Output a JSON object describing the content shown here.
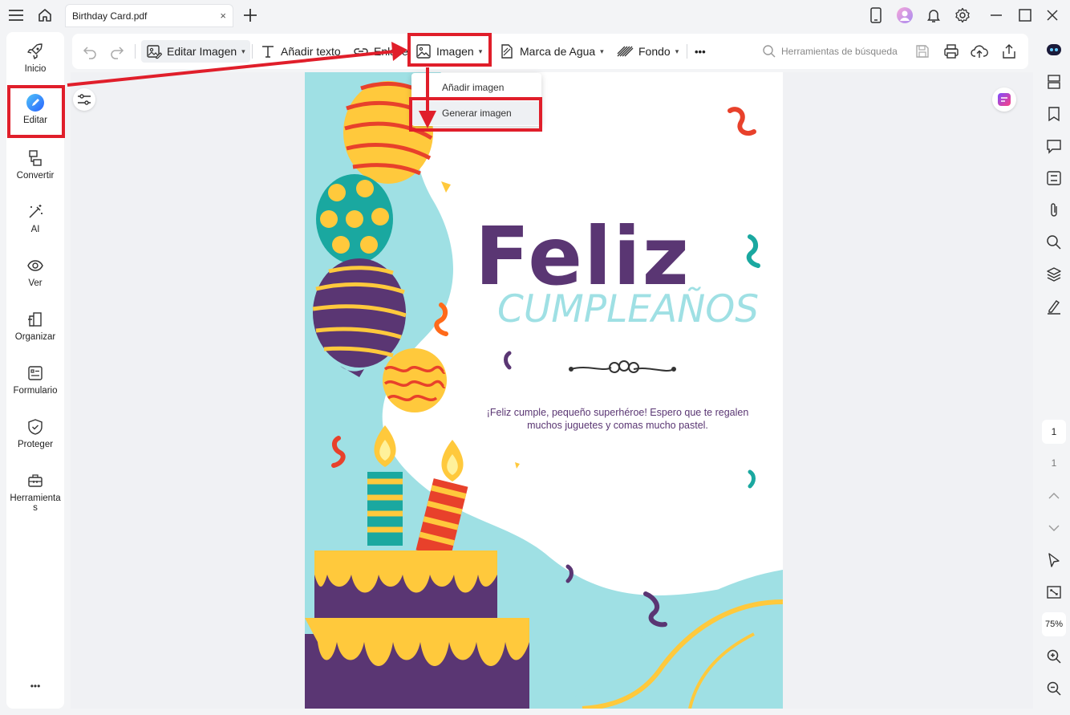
{
  "tab": {
    "title": "Birthday Card.pdf",
    "close": "×"
  },
  "sidebar": {
    "items": [
      {
        "label": "Inicio"
      },
      {
        "label": "Editar"
      },
      {
        "label": "Convertir"
      },
      {
        "label": "AI"
      },
      {
        "label": "Ver"
      },
      {
        "label": "Organizar"
      },
      {
        "label": "Formulario"
      },
      {
        "label": "Proteger"
      },
      {
        "label": "Herramientas"
      }
    ],
    "more": "•••"
  },
  "toolbar": {
    "edit_image": "Editar Imagen",
    "add_text": "Añadir texto",
    "link": "Enlace",
    "image": "Imagen",
    "watermark": "Marca de Agua",
    "background": "Fondo",
    "more": "•••",
    "search_placeholder": "Herramientas de búsqueda"
  },
  "image_menu": {
    "items": [
      {
        "label": "Añadir imagen"
      },
      {
        "label": "Generar imagen"
      }
    ]
  },
  "card": {
    "title_line1": "Feliz",
    "title_line2": "CUMPLEAÑOS",
    "message_line1": "¡Feliz cumple, pequeño superhéroe! Espero que te regalen",
    "message_line2": "muchos juguetes y comas mucho pastel."
  },
  "pager": {
    "current": "1",
    "total": "1",
    "zoom": "75%"
  },
  "colors": {
    "accent_red": "#e01e2a",
    "purple": "#5a3673",
    "teal": "#9fe0e4",
    "yellow": "#ffc93c"
  }
}
